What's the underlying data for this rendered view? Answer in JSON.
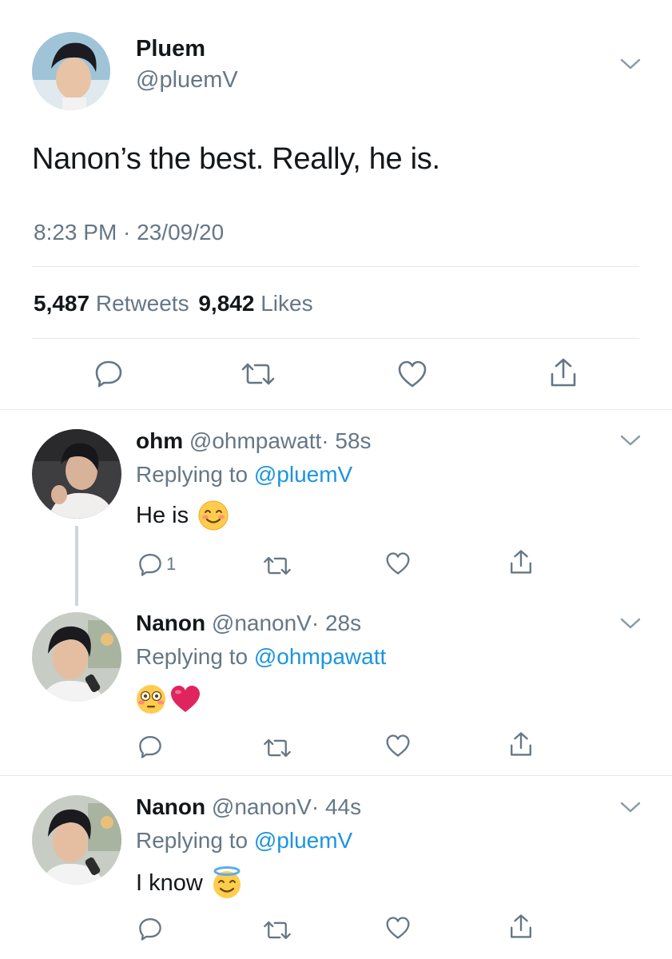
{
  "main_tweet": {
    "display_name": "Pluem",
    "handle": "@pluemV",
    "text": "Nanon’s the best. Really, he is.",
    "timestamp": "8:23 PM · 23/09/20",
    "retweets_count": "5,487",
    "retweets_label": "Retweets",
    "likes_count": "9,842",
    "likes_label": "Likes"
  },
  "replies": [
    {
      "display_name": "ohm",
      "handle": "@ohmpawatt",
      "time": "· 58s",
      "replying_prefix": "Replying to",
      "replying_to": "@pluemV",
      "text": "He is",
      "emoji": "smiling-face",
      "reply_count": "1"
    },
    {
      "display_name": "Nanon",
      "handle": "@nanonV",
      "time": "· 28s",
      "replying_prefix": "Replying to",
      "replying_to": "@ohmpawatt",
      "text": "",
      "emoji": "flushed-face, red-heart"
    },
    {
      "display_name": "Nanon",
      "handle": "@nanonV",
      "time": "· 44s",
      "replying_prefix": "Replying to",
      "replying_to": "@pluemV",
      "text": "I know",
      "emoji": "smiling-face-with-halo"
    }
  ],
  "colors": {
    "text": "#14171a",
    "secondary": "#657786",
    "link": "#1b95e0",
    "divider": "#e1e8ed",
    "heart_emoji": "#e0245e",
    "emoji_yellow": "#ffcc4d"
  }
}
